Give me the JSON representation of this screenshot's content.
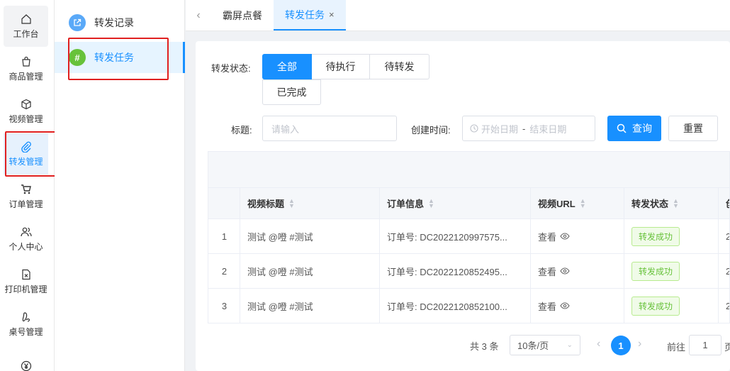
{
  "nav": {
    "items": [
      {
        "label": "工作台",
        "icon": "home-icon"
      },
      {
        "label": "商品管理",
        "icon": "shopping-bag-icon"
      },
      {
        "label": "视频管理",
        "icon": "cube-icon"
      },
      {
        "label": "转发管理",
        "icon": "paperclip-icon"
      },
      {
        "label": "订单管理",
        "icon": "cart-icon"
      },
      {
        "label": "个人中心",
        "icon": "users-icon"
      },
      {
        "label": "打印机管理",
        "icon": "file-x-icon"
      },
      {
        "label": "桌号管理",
        "icon": "footprint-icon"
      },
      {
        "label": "",
        "icon": "yen-icon"
      }
    ],
    "active_index": 3
  },
  "submenu": {
    "items": [
      {
        "label": "转发记录",
        "icon": "external-link-icon",
        "color": "#5aa9f8"
      },
      {
        "label": "转发任务",
        "icon": "hash-icon",
        "color": "#67c23a",
        "glyph": "#"
      }
    ]
  },
  "tabs": [
    {
      "label": "霸屏点餐"
    },
    {
      "label": "转发任务",
      "close": "×"
    }
  ],
  "filters": {
    "status_label": "转发状态:",
    "status_options": [
      "全部",
      "待执行",
      "待转发",
      "已完成"
    ],
    "title_label": "标题:",
    "title_placeholder": "请输入",
    "date_label": "创建时间:",
    "date_start": "开始日期",
    "date_sep": "-",
    "date_end": "结束日期",
    "search_button": "查询",
    "reset_button": "重置"
  },
  "table": {
    "columns": [
      "视频标题",
      "订单信息",
      "视频URL",
      "转发状态",
      "创"
    ],
    "rows": [
      {
        "index": "1",
        "title": "测试 @噔 #测试",
        "order": "订单号: DC2022120997575...",
        "url": "查看",
        "status": "转发成功",
        "extra": "2"
      },
      {
        "index": "2",
        "title": "测试 @噔 #测试",
        "order": "订单号: DC2022120852495...",
        "url": "查看",
        "status": "转发成功",
        "extra": "2"
      },
      {
        "index": "3",
        "title": "测试 @噔 #测试",
        "order": "订单号: DC2022120852100...",
        "url": "查看",
        "status": "转发成功",
        "extra": "2"
      }
    ]
  },
  "pagination": {
    "total": "共 3 条",
    "page_size": "10条/页",
    "current": "1",
    "goto_label": "前往",
    "goto_value": "1",
    "goto_suffix": "页"
  },
  "colors": {
    "accent": "#1890ff",
    "success": "#67c23a",
    "highlight": "#e02020"
  }
}
